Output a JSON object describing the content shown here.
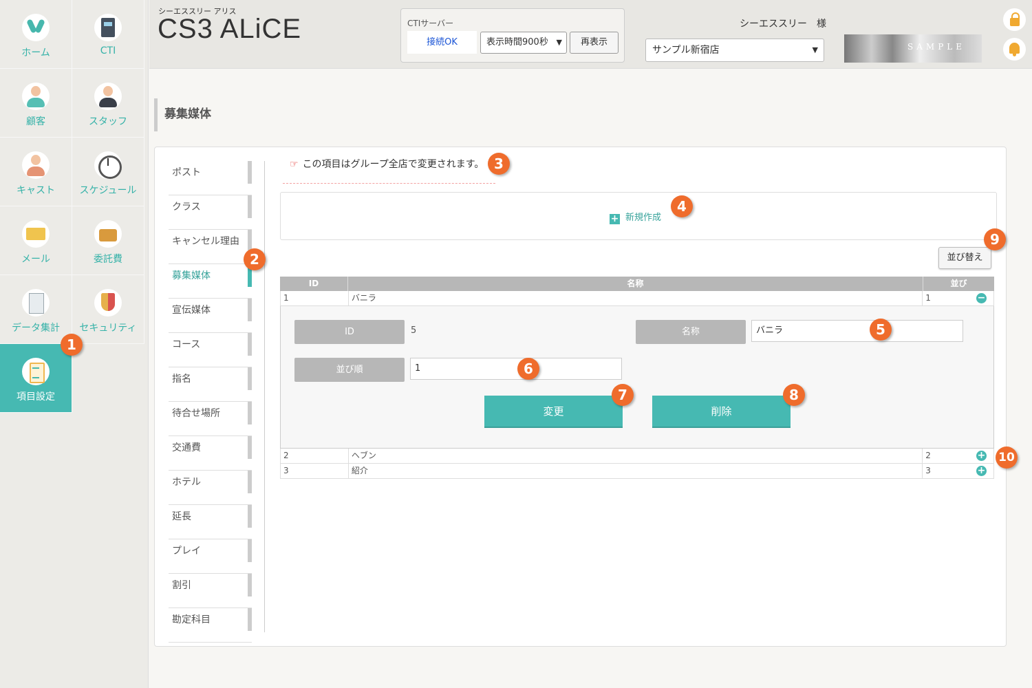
{
  "nav": {
    "items": [
      {
        "label": "ホーム",
        "icon": "rabbit-icon"
      },
      {
        "label": "CTI",
        "icon": "phone-icon"
      },
      {
        "label": "顧客",
        "icon": "customer-icon"
      },
      {
        "label": "スタッフ",
        "icon": "staff-icon"
      },
      {
        "label": "キャスト",
        "icon": "cast-icon"
      },
      {
        "label": "スケジュール",
        "icon": "clock-icon"
      },
      {
        "label": "メール",
        "icon": "mail-icon"
      },
      {
        "label": "委託費",
        "icon": "wallet-icon"
      },
      {
        "label": "データ集計",
        "icon": "chart-icon"
      },
      {
        "label": "セキュリティ",
        "icon": "shield-icon"
      },
      {
        "label": "項目設定",
        "icon": "clipboard-icon",
        "active": true
      }
    ]
  },
  "header": {
    "app_subtitle": "シーエススリー アリス",
    "app_title": "CS3 ALiCE",
    "cti": {
      "label": "CTIサーバー",
      "status": "接続OK",
      "display_time": "表示時間900秒",
      "refresh_label": "再表示"
    },
    "user": "シーエススリー　様",
    "store_select": "サンプル新宿店",
    "logo_text": "SAMPLE"
  },
  "page_title": "募集媒体",
  "submenu": [
    {
      "label": "ポスト"
    },
    {
      "label": "クラス"
    },
    {
      "label": "キャンセル理由"
    },
    {
      "label": "募集媒体",
      "active": true
    },
    {
      "label": "宣伝媒体"
    },
    {
      "label": "コース"
    },
    {
      "label": "指名"
    },
    {
      "label": "待合せ場所"
    },
    {
      "label": "交通費"
    },
    {
      "label": "ホテル"
    },
    {
      "label": "延長"
    },
    {
      "label": "プレイ"
    },
    {
      "label": "割引"
    },
    {
      "label": "勘定科目"
    }
  ],
  "notice": "この項目はグループ全店で変更されます。",
  "new_label": "新規作成",
  "sort_label": "並び替え",
  "table": {
    "headers": [
      "ID",
      "名称",
      "並び"
    ],
    "rows": [
      {
        "id": "1",
        "name": "バニラ",
        "order": "1",
        "toggle": "−"
      },
      {
        "id": "2",
        "name": "ヘブン",
        "order": "2",
        "toggle": "+"
      },
      {
        "id": "3",
        "name": "紹介",
        "order": "3",
        "toggle": "+"
      }
    ]
  },
  "edit": {
    "id_label": "ID",
    "id_value": "5",
    "name_label": "名称",
    "name_value": "バニラ",
    "order_label": "並び順",
    "order_value": "1",
    "update_label": "変更",
    "delete_label": "削除"
  },
  "badges": [
    "1",
    "2",
    "3",
    "4",
    "5",
    "6",
    "7",
    "8",
    "9",
    "10"
  ],
  "colors": {
    "accent": "#46b9b2",
    "badge": "#ef6c2c",
    "link": "#1a54d6"
  }
}
